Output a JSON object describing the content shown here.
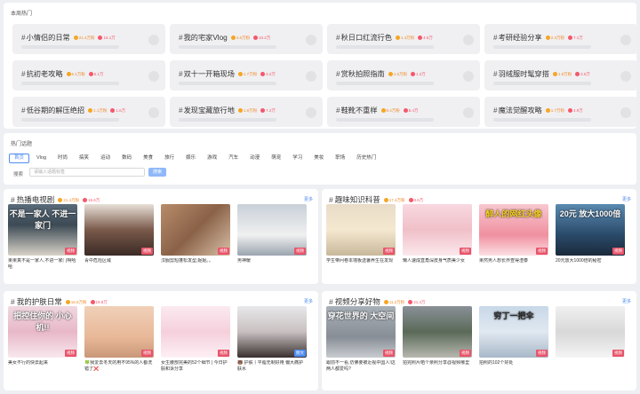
{
  "hot_section": {
    "title": "本周热门",
    "items": [
      {
        "title": "小情侣的日常",
        "views": "21.4万粉",
        "likes": "16.1万"
      },
      {
        "title": "我的宅家Vlog",
        "views": "4.6万粉",
        "likes": "10.2万"
      },
      {
        "title": "秋日口红流行色",
        "views": "1.4万粉",
        "likes": "4.5万"
      },
      {
        "title": "考研经验分享",
        "views": "2.3万粉",
        "likes": "7.1万"
      },
      {
        "title": "抗初老攻略",
        "views": "6.1万粉",
        "likes": "5.1万"
      },
      {
        "title": "双十一开箱现场",
        "views": "1.7万粉",
        "likes": "3.2万"
      },
      {
        "title": "赏秋拍照指南",
        "views": "1.6万粉",
        "likes": "1.2万"
      },
      {
        "title": "羽绒服时髦穿搭",
        "views": "1.8万粉",
        "likes": "3.6万"
      },
      {
        "title": "低谷期的解压绝招",
        "views": "1.1万粉",
        "likes": "1.6万"
      },
      {
        "title": "发现宝藏旅行地",
        "views": "1.9万粉",
        "likes": "7.2万"
      },
      {
        "title": "鞋靴不重样",
        "views": "9.4万粉",
        "likes": "5.4万"
      },
      {
        "title": "魔法觉醒攻略",
        "views": "1.7万粉",
        "likes": "4.9万"
      }
    ]
  },
  "topics": {
    "title": "热门话题",
    "tabs": [
      "首页",
      "Vlog",
      "时尚",
      "搞笑",
      "运动",
      "数码",
      "美食",
      "旅行",
      "娱乐",
      "游戏",
      "汽车",
      "动漫",
      "萌宠",
      "学习",
      "美妆",
      "职场",
      "历史热门"
    ],
    "search_label": "搜索",
    "search_placeholder": "请输入话题标签",
    "search_button": "搜索"
  },
  "categories": [
    {
      "title": "热播电视剧",
      "views": "21.4万粉",
      "likes": "16.6万",
      "more": "更多",
      "items": [
        {
          "caption": "果果真不是一家人,不进一家门啊哈哈",
          "badge": "视频",
          "overlay": "不是一家人 不进一家门"
        },
        {
          "caption": "青中危险区域",
          "badge": "视频",
          "overlay": ""
        },
        {
          "caption": "汉服剪短蓬松发型,妮妮。。",
          "badge": "视频",
          "overlay": ""
        },
        {
          "caption": "男神暖",
          "badge": "视频",
          "overlay": ""
        }
      ]
    },
    {
      "title": "趣味知识科普",
      "views": "17.4万粉",
      "likes": "8.6万",
      "more": "更多",
      "items": [
        {
          "caption": "学生带问卷本墙板送暑养生在发现",
          "badge": "视频",
          "overlay": ""
        },
        {
          "caption": "懒人速成直角深皮身气质美少女",
          "badge": "视频",
          "overlay": ""
        },
        {
          "caption": "果然男人想长界查得渣泰",
          "badge": "视频",
          "overlay": "醉人的网红头像"
        },
        {
          "caption": "20元放大1000倍的秘密",
          "badge": "视频",
          "overlay": "20元 放大1000倍"
        }
      ]
    },
    {
      "title": "我的护肤日常",
      "views": "16.5万粉",
      "likes": "19.8万",
      "more": "更多",
      "items": [
        {
          "caption": "美女不行的快去起来",
          "badge": "视频",
          "overlay": "把控住你的 小心机!!"
        },
        {
          "caption": "🍀我爱去冬天的用不95%的人都洗错了❌",
          "badge": "视频",
          "overlay": ""
        },
        {
          "caption": "女生腰部完美的52个细节 | 今日护肤和诉分享",
          "badge": "视频",
          "overlay": ""
        },
        {
          "caption": "🐻 护肤丨平脂无制好用 偏大痛护肤水",
          "badge": "图文",
          "overlay": ""
        }
      ]
    },
    {
      "title": "视频分享好物",
      "views": "11.2万粉",
      "likes": "21.4万",
      "more": "更多",
      "items": [
        {
          "caption": "跟前不一看,仿佛要被近视中国人!这两人都爱吗?",
          "badge": "视频",
          "overlay": "穿花世界的 大空间"
        },
        {
          "caption": "拍完照片晒个亲照分享@视频哪里",
          "badge": "视频",
          "overlay": ""
        },
        {
          "caption": "拍照的102个好处",
          "badge": "视频",
          "overlay": "穷丁一把伞"
        },
        {
          "caption": "",
          "badge": "视频",
          "overlay": ""
        }
      ]
    }
  ],
  "colors": {
    "accent": "#4e8cf0",
    "orange": "#f5a623",
    "red": "#f5576c"
  }
}
